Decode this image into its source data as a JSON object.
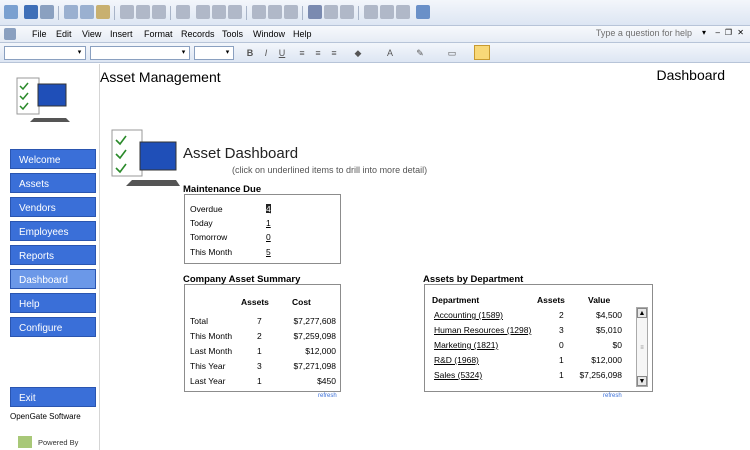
{
  "menu": [
    "File",
    "Edit",
    "View",
    "Insert",
    "Format",
    "Records",
    "Tools",
    "Window",
    "Help"
  ],
  "help_placeholder": "Type a question for help",
  "header": {
    "app_title": "Asset Management",
    "page_title": "Dashboard"
  },
  "nav": [
    "Welcome",
    "Assets",
    "Vendors",
    "Employees",
    "Reports",
    "Dashboard",
    "Help",
    "Configure"
  ],
  "nav_active": "Dashboard",
  "exit_label": "Exit",
  "company": "OpenGate Software",
  "powered": "Powered By",
  "dashboard": {
    "title": "Asset Dashboard",
    "subtitle": "(click on underlined items to drill into more detail)"
  },
  "maintenance": {
    "title": "Maintenance Due",
    "rows": [
      {
        "label": "Overdue",
        "value": "4"
      },
      {
        "label": "Today",
        "value": "1"
      },
      {
        "label": "Tomorrow",
        "value": "0"
      },
      {
        "label": "This Month",
        "value": "5"
      }
    ]
  },
  "summary": {
    "title": "Company Asset Summary",
    "col_assets": "Assets",
    "col_cost": "Cost",
    "rows": [
      {
        "label": "Total",
        "assets": "7",
        "cost": "$7,277,608"
      },
      {
        "label": "This Month",
        "assets": "2",
        "cost": "$7,259,098"
      },
      {
        "label": "Last Month",
        "assets": "1",
        "cost": "$12,000"
      },
      {
        "label": "This Year",
        "assets": "3",
        "cost": "$7,271,098"
      },
      {
        "label": "Last Year",
        "assets": "1",
        "cost": "$450"
      }
    ],
    "refresh": "refresh"
  },
  "departments": {
    "title": "Assets by Department",
    "col_dept": "Department",
    "col_assets": "Assets",
    "col_value": "Value",
    "rows": [
      {
        "name": "Accounting (1589)",
        "assets": "2",
        "value": "$4,500"
      },
      {
        "name": "Human Resources (1298)",
        "assets": "3",
        "value": "$5,010"
      },
      {
        "name": "Marketing (1821)",
        "assets": "0",
        "value": "$0"
      },
      {
        "name": "R&D (1968)",
        "assets": "1",
        "value": "$12,000"
      },
      {
        "name": "Sales (5324)",
        "assets": "1",
        "value": "$7,256,098"
      }
    ],
    "refresh": "refresh"
  }
}
